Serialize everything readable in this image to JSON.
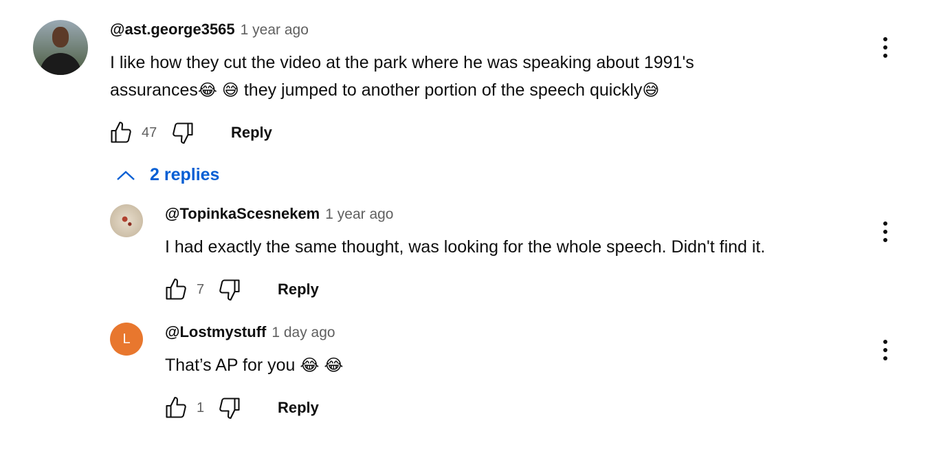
{
  "comments": [
    {
      "author": "@ast.george3565",
      "time": "1 year ago",
      "line1": "I like how they cut the video at the park where he was speaking about 1991's",
      "line2_a": "assurances",
      "line2_e1": "😂",
      "line2_e2": "😅",
      "line2_b": "they jumped to another portion of the speech quickly",
      "line2_e3": "😅",
      "likes": "47",
      "reply_label": "Reply"
    }
  ],
  "replies_toggle": {
    "label": "2 replies",
    "icon": "chevron-up-icon"
  },
  "replies": [
    {
      "author": "@TopinkaScesnekem",
      "time": "1 year ago",
      "text": "I had exactly the same thought, was looking for the whole speech. Didn't find it.",
      "likes": "7",
      "reply_label": "Reply"
    },
    {
      "author": "@Lostmystuff",
      "time": "1 day ago",
      "avatar_letter": "L",
      "text": "That’s AP for you",
      "e1": "😂",
      "e2": "😂",
      "likes": "1",
      "reply_label": "Reply"
    }
  ],
  "colors": {
    "link": "#065fd4",
    "secondary_text": "#606060",
    "avatar_L": "#e8772e"
  },
  "icons": [
    "thumbs-up-icon",
    "thumbs-down-icon",
    "more-vert-icon",
    "chevron-up-icon"
  ]
}
